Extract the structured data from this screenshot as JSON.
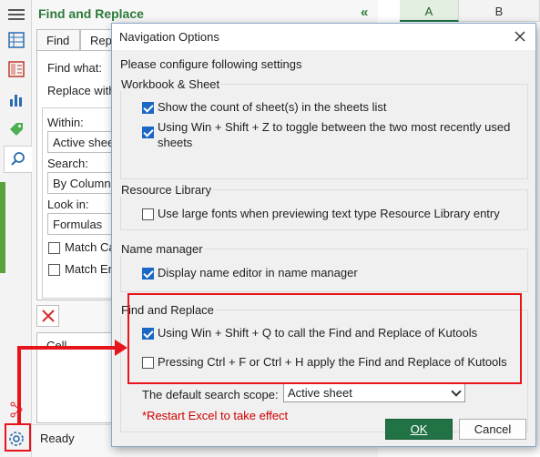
{
  "pane": {
    "title": "Find and Replace",
    "tabs": [
      "Find",
      "Replace"
    ],
    "find_what_label": "Find what:",
    "replace_with_label": "Replace with:",
    "within_label": "Within:",
    "within_value": "Active sheet",
    "search_label": "Search:",
    "search_value": "By Columns",
    "look_in_label": "Look in:",
    "look_in_value": "Formulas",
    "match_case_label": "Match Case",
    "match_entire_label": "Match Entire cell",
    "results_header": "Cell",
    "status": "Ready"
  },
  "sheet": {
    "columns": [
      "A",
      "B"
    ]
  },
  "dialog": {
    "title": "Navigation Options",
    "intro": "Please configure following settings",
    "groups": {
      "workbook": {
        "title": "Workbook & Sheet",
        "show_count": {
          "label": "Show the count of sheet(s) in the sheets list",
          "checked": true
        },
        "toggle_sheets": {
          "label": "Using Win + Shift + Z to toggle between the two most recently used sheets",
          "checked": true
        }
      },
      "resource": {
        "title": "Resource Library",
        "large_fonts": {
          "label": "Use large fonts when previewing text type Resource Library entry",
          "checked": false
        }
      },
      "name_manager": {
        "title": "Name manager",
        "display_editor": {
          "label": "Display name editor in name manager",
          "checked": true
        }
      },
      "find_replace": {
        "title": "Find and Replace",
        "win_shift_q": {
          "label": "Using Win + Shift + Q to call the Find and Replace of Kutools",
          "checked": true
        },
        "ctrl_f_h": {
          "label": "Pressing Ctrl + F or Ctrl + H apply the Find and Replace of Kutools",
          "checked": false
        },
        "scope_label": "The default search scope:",
        "scope_value": "Active sheet",
        "restart_note": "*Restart Excel to take effect"
      }
    },
    "ok_label": "OK",
    "cancel_label": "Cancel"
  },
  "colors": {
    "accent_green": "#217346",
    "annotation_red": "#e8141c",
    "checkbox_blue": "#1a67c4"
  },
  "icons": [
    "menu-icon",
    "sheet-list-icon",
    "workbook-icon",
    "chart-icon",
    "tag-icon",
    "search-icon",
    "settings-gear-icon",
    "close-icon"
  ]
}
